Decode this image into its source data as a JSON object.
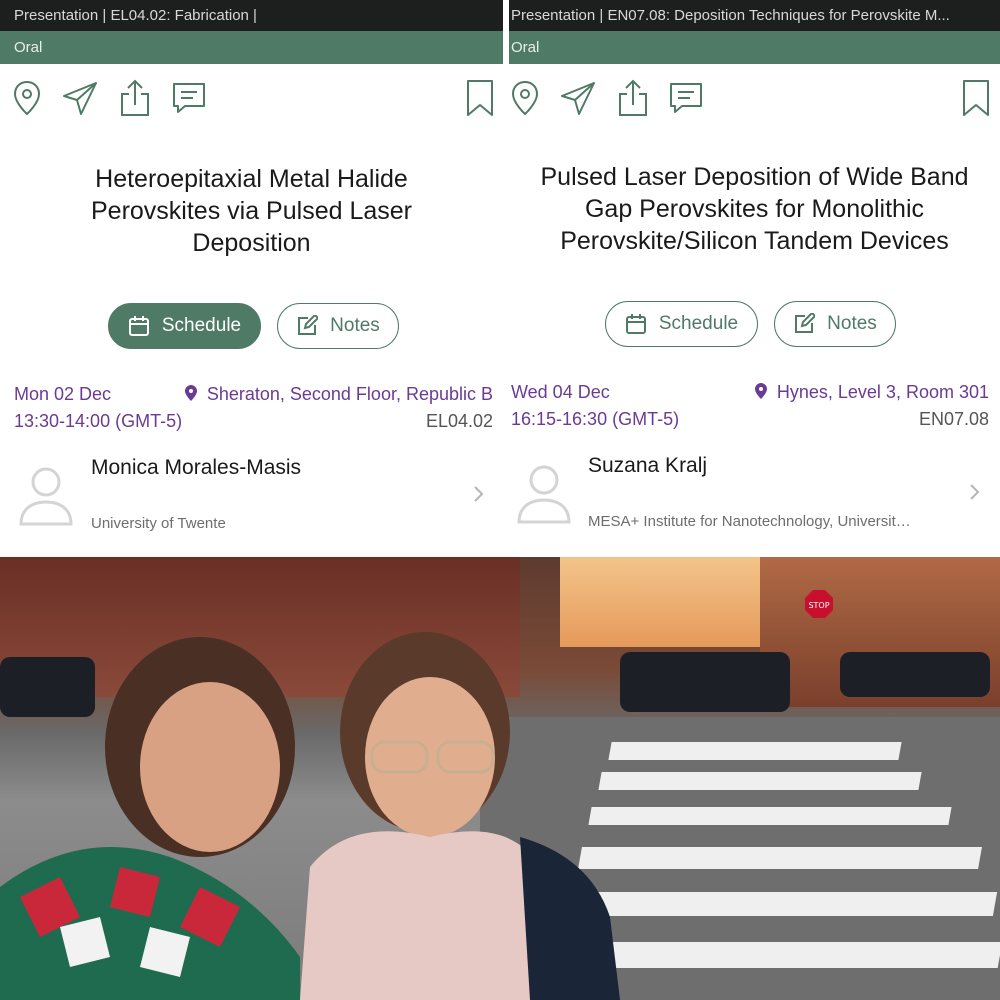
{
  "colors": {
    "brand_green": "#4f7a65",
    "meta_purple": "#6b3a93",
    "topbar_dark": "#1d1f1e"
  },
  "left": {
    "topbar": "Presentation | EL04.02: Fabrication |",
    "type": "Oral",
    "icons": [
      "location-pin-icon",
      "send-icon",
      "share-icon",
      "comment-icon",
      "bookmark-icon"
    ],
    "title": "Heteroepitaxial Metal Halide Perovskites via Pulsed Laser Deposition",
    "schedule_label": "Schedule",
    "notes_label": "Notes",
    "date": "Mon 02 Dec",
    "time": "13:30-14:00 (GMT-5)",
    "location": "Sheraton, Second Floor, Republic B",
    "code": "EL04.02",
    "speaker": "Monica Morales-Masis",
    "affiliation": "University of Twente"
  },
  "right": {
    "topbar": "Presentation | EN07.08: Deposition Techniques for Perovskite M...",
    "type": "Oral",
    "icons": [
      "location-pin-icon",
      "send-icon",
      "share-icon",
      "comment-icon",
      "bookmark-icon"
    ],
    "title": "Pulsed Laser Deposition of Wide Band Gap Perovskites for Monolithic Perovskite/Silicon Tandem Devices",
    "schedule_label": "Schedule",
    "notes_label": "Notes",
    "date": "Wed 04 Dec",
    "time": "16:15-16:30 (GMT-5)",
    "location": "Hynes, Level 3, Room 301",
    "code": "EN07.08",
    "speaker": "Suzana Kralj",
    "affiliation": "MESA+ Institute for Nanotechnology, Universit…"
  },
  "photo": {
    "sign_text": "STOP"
  }
}
